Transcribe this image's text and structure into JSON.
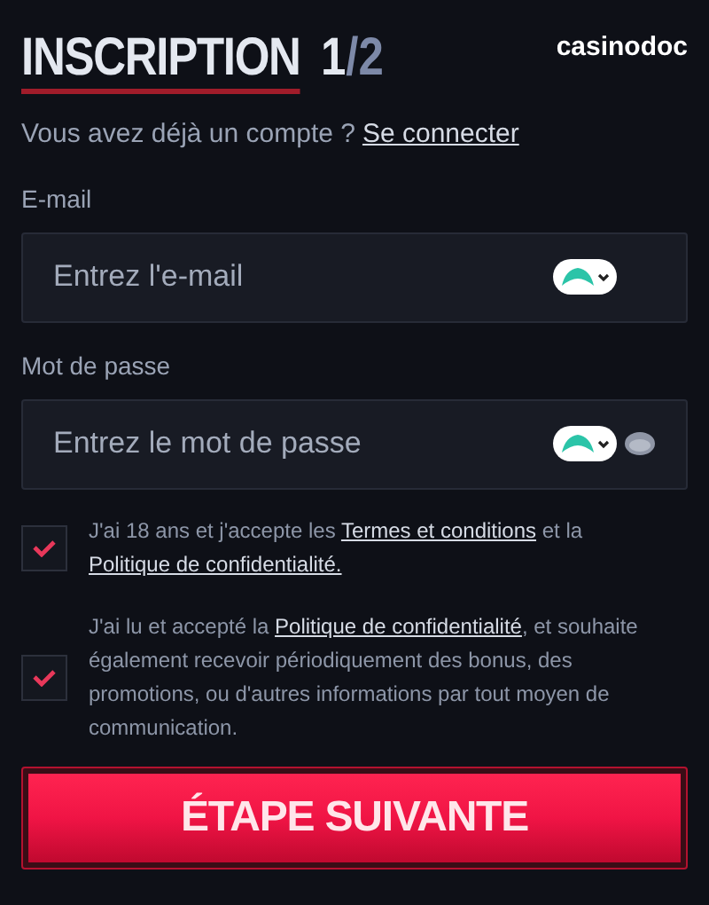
{
  "header": {
    "title": "INSCRIPTION",
    "step_current": "1",
    "step_total": "/2",
    "logo": "casinodoc"
  },
  "login_prompt": {
    "text": "Vous avez déjà un compte ?",
    "link": "Se connecter"
  },
  "fields": [
    {
      "label": "E-mail",
      "placeholder": "Entrez l'e-mail",
      "kind": "email"
    },
    {
      "label": "Mot de passe",
      "placeholder": "Entrez le mot de passe",
      "kind": "password"
    }
  ],
  "consents": [
    {
      "checked": true,
      "parts": [
        {
          "kind": "text",
          "text": "J'ai 18 ans et j'accepte les "
        },
        {
          "kind": "link",
          "text": "Termes et conditions"
        },
        {
          "kind": "text",
          "text": " et la "
        },
        {
          "kind": "link",
          "text": "Politique de confidentialité."
        }
      ]
    },
    {
      "checked": true,
      "parts": [
        {
          "kind": "text",
          "text": "J'ai lu et accepté la "
        },
        {
          "kind": "link",
          "text": "Politique de confidentialité"
        },
        {
          "kind": "text",
          "text": ", et souhaite également recevoir périodiquement des bonus, des promotions, ou d'autres informations par tout moyen de communication."
        }
      ]
    }
  ],
  "submit": {
    "label": "ÉTAPE SUIVANTE"
  }
}
